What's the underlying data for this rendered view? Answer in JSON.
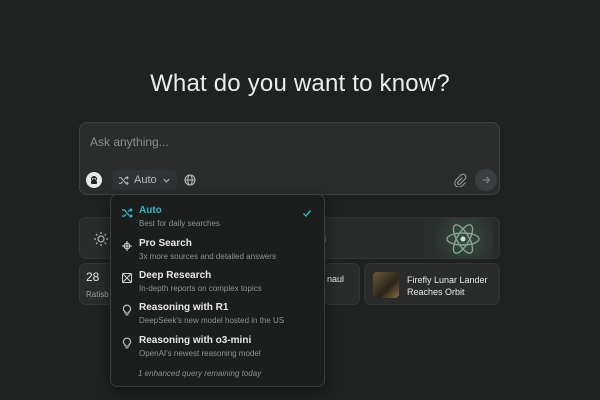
{
  "heading": "What do you want to know?",
  "search": {
    "placeholder": "Ask anything...",
    "mode_label": "Auto"
  },
  "cards": {
    "a_suffix": "d",
    "b_value": "28",
    "b_sub": "Ratisb",
    "c_text": "naul",
    "d_title": "Firefly Lunar Lander Reaches Orbit"
  },
  "menu": {
    "options": [
      {
        "label": "Auto",
        "sub": "Best for daily searches",
        "icon": "shuffle-icon",
        "selected": true
      },
      {
        "label": "Pro Search",
        "sub": "3x more sources and detailed answers",
        "icon": "pro-search-icon"
      },
      {
        "label": "Deep Research",
        "sub": "In-depth reports on complex topics",
        "icon": "deep-research-icon"
      },
      {
        "label": "Reasoning with R1",
        "sub": "DeepSeek's new model hosted in the US",
        "icon": "lightbulb-icon"
      },
      {
        "label": "Reasoning with o3-mini",
        "sub": "OpenAI's newest reasoning model",
        "icon": "lightbulb-icon"
      }
    ],
    "footer": "1 enhanced query remaining today"
  },
  "colors": {
    "background": "#202222",
    "accent": "#2eb8c7"
  }
}
